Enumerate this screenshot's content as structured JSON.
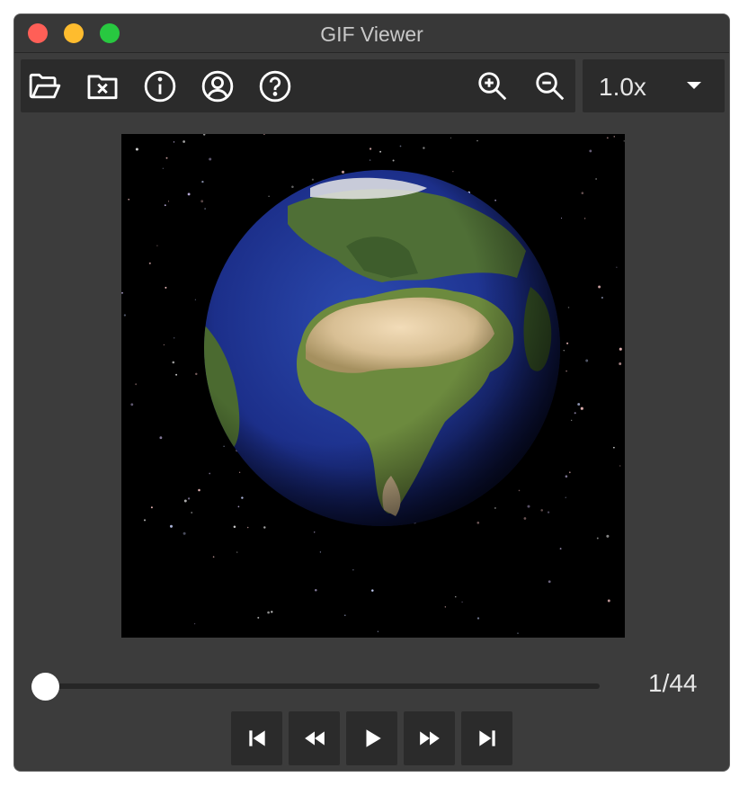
{
  "window": {
    "title": "GIF Viewer"
  },
  "toolbar": {
    "icons": [
      "open-folder-icon",
      "close-file-icon",
      "info-icon",
      "account-icon",
      "help-icon",
      "zoom-in-icon",
      "zoom-out-icon"
    ]
  },
  "zoom": {
    "value": "1.0x"
  },
  "playback": {
    "current_frame": 1,
    "total_frames": 44,
    "counter_label": "1/44",
    "buttons": [
      "first-frame",
      "previous-frame",
      "play",
      "next-frame",
      "last-frame"
    ]
  },
  "colors": {
    "window_bg": "#3c3c3c",
    "panel_bg": "#2b2b2b",
    "text": "#e6e6e6",
    "traffic_close": "#ff5f57",
    "traffic_min": "#febc2e",
    "traffic_max": "#28c840"
  }
}
